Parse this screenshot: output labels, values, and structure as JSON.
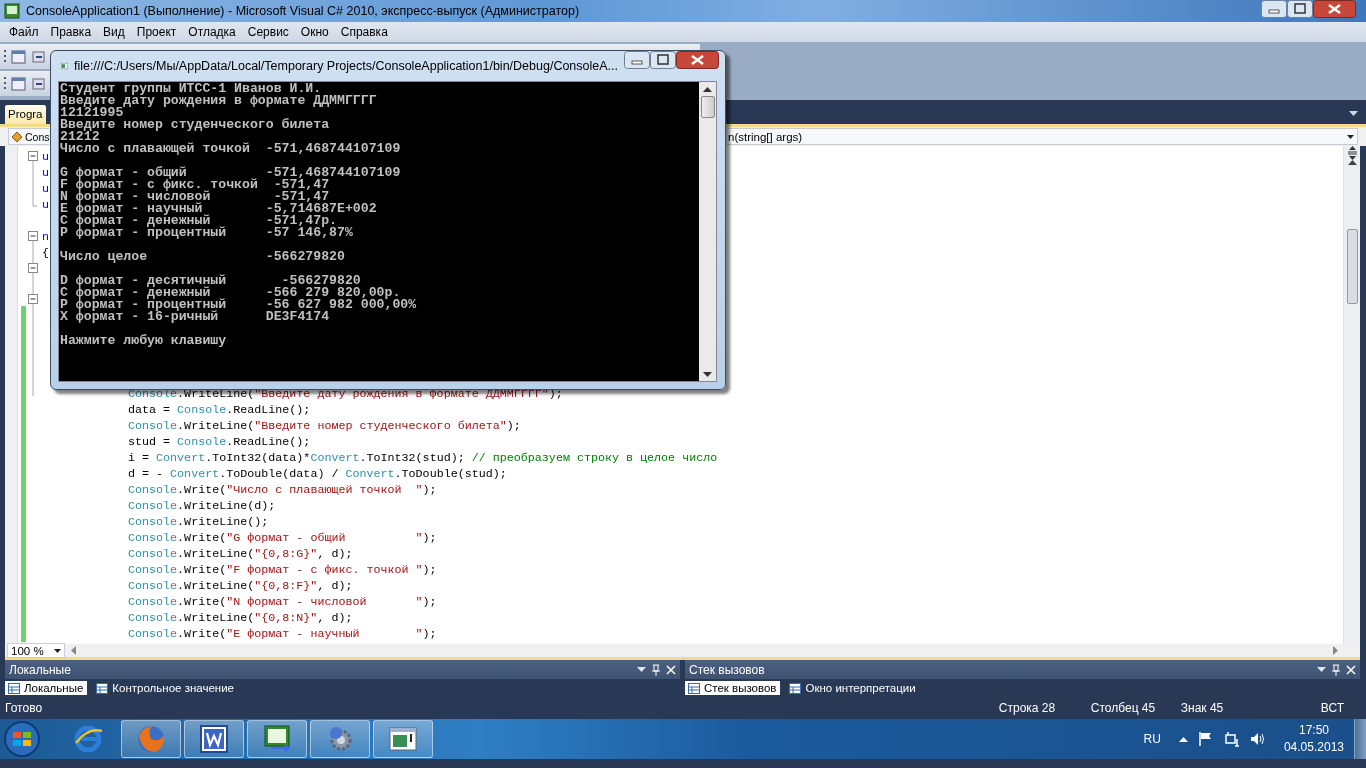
{
  "window": {
    "title": "ConsoleApplication1 (Выполнение) - Microsoft Visual C# 2010, экспресс-выпуск (Администратор)"
  },
  "menu": [
    "Файл",
    "Правка",
    "Вид",
    "Проект",
    "Отладка",
    "Сервис",
    "Окно",
    "Справка"
  ],
  "document_tabs": [
    {
      "label": "Progra",
      "selected": true
    }
  ],
  "navigation": {
    "type_combo": "Cons",
    "member_combo": "n(string[] args)"
  },
  "editor": {
    "fragments": [
      {
        "kind": "using",
        "text": "u"
      },
      {
        "kind": "using",
        "text": "u"
      },
      {
        "kind": "using",
        "text": "u"
      },
      {
        "kind": "using",
        "text": "u"
      },
      {
        "kind": "namespace",
        "text": "n"
      },
      {
        "kind": "brace",
        "text": "{"
      }
    ],
    "lines": [
      [
        {
          "kind": "type",
          "text": "Console"
        },
        {
          "kind": "plain",
          "text": ".WriteLine("
        },
        {
          "kind": "string",
          "text": "\"Введите дату рождения в формате ДДММГГГГ\""
        },
        {
          "kind": "plain",
          "text": ");"
        }
      ],
      [
        {
          "kind": "plain",
          "text": "data = "
        },
        {
          "kind": "type",
          "text": "Console"
        },
        {
          "kind": "plain",
          "text": ".ReadLine();"
        }
      ],
      [
        {
          "kind": "type",
          "text": "Console"
        },
        {
          "kind": "plain",
          "text": ".WriteLine("
        },
        {
          "kind": "string",
          "text": "\"Введите номер студенческого билета\""
        },
        {
          "kind": "plain",
          "text": ");"
        }
      ],
      [
        {
          "kind": "plain",
          "text": "stud = "
        },
        {
          "kind": "type",
          "text": "Console"
        },
        {
          "kind": "plain",
          "text": ".ReadLine();"
        }
      ],
      [
        {
          "kind": "plain",
          "text": "i = "
        },
        {
          "kind": "type",
          "text": "Convert"
        },
        {
          "kind": "plain",
          "text": ".ToInt32(data)*"
        },
        {
          "kind": "type",
          "text": "Convert"
        },
        {
          "kind": "plain",
          "text": ".ToInt32(stud); "
        },
        {
          "kind": "comment",
          "text": "// преобразуем строку в целое число"
        }
      ],
      [
        {
          "kind": "plain",
          "text": "d = - "
        },
        {
          "kind": "type",
          "text": "Convert"
        },
        {
          "kind": "plain",
          "text": ".ToDouble(data) / "
        },
        {
          "kind": "type",
          "text": "Convert"
        },
        {
          "kind": "plain",
          "text": ".ToDouble(stud);"
        }
      ],
      [
        {
          "kind": "type",
          "text": "Console"
        },
        {
          "kind": "plain",
          "text": ".Write("
        },
        {
          "kind": "string",
          "text": "\"Число с плавающей точкой  \""
        },
        {
          "kind": "plain",
          "text": ");"
        }
      ],
      [
        {
          "kind": "type",
          "text": "Console"
        },
        {
          "kind": "plain",
          "text": ".WriteLine(d);"
        }
      ],
      [
        {
          "kind": "type",
          "text": "Console"
        },
        {
          "kind": "plain",
          "text": ".WriteLine();"
        }
      ],
      [
        {
          "kind": "type",
          "text": "Console"
        },
        {
          "kind": "plain",
          "text": ".Write("
        },
        {
          "kind": "string",
          "text": "\"G формат - общий          \""
        },
        {
          "kind": "plain",
          "text": ");"
        }
      ],
      [
        {
          "kind": "type",
          "text": "Console"
        },
        {
          "kind": "plain",
          "text": ".WriteLine("
        },
        {
          "kind": "string",
          "text": "\"{0,8:G}\""
        },
        {
          "kind": "plain",
          "text": ", d);"
        }
      ],
      [
        {
          "kind": "type",
          "text": "Console"
        },
        {
          "kind": "plain",
          "text": ".Write("
        },
        {
          "kind": "string",
          "text": "\"F формат - с фикс. точкой \""
        },
        {
          "kind": "plain",
          "text": ");"
        }
      ],
      [
        {
          "kind": "type",
          "text": "Console"
        },
        {
          "kind": "plain",
          "text": ".WriteLine("
        },
        {
          "kind": "string",
          "text": "\"{0,8:F}\""
        },
        {
          "kind": "plain",
          "text": ", d);"
        }
      ],
      [
        {
          "kind": "type",
          "text": "Console"
        },
        {
          "kind": "plain",
          "text": ".Write("
        },
        {
          "kind": "string",
          "text": "\"N формат - числовой       \""
        },
        {
          "kind": "plain",
          "text": ");"
        }
      ],
      [
        {
          "kind": "type",
          "text": "Console"
        },
        {
          "kind": "plain",
          "text": ".WriteLine("
        },
        {
          "kind": "string",
          "text": "\"{0,8:N}\""
        },
        {
          "kind": "plain",
          "text": ", d);"
        }
      ],
      [
        {
          "kind": "type",
          "text": "Console"
        },
        {
          "kind": "plain",
          "text": ".Write("
        },
        {
          "kind": "string",
          "text": "\"E формат - научный        \""
        },
        {
          "kind": "plain",
          "text": ");"
        }
      ]
    ],
    "zoom": "100 %"
  },
  "panels": [
    {
      "title": "Локальные",
      "tabs": [
        {
          "label": "Локальные",
          "selected": true
        },
        {
          "label": "Контрольное значение",
          "selected": false
        }
      ]
    },
    {
      "title": "Стек вызовов",
      "tabs": [
        {
          "label": "Стек вызовов",
          "selected": true
        },
        {
          "label": "Окно интерпретации",
          "selected": false
        }
      ]
    }
  ],
  "status_bar": {
    "message": "Готово",
    "line": "Строка 28",
    "column": "Столбец 45",
    "char": "Знак 45",
    "mode": "ВСТ"
  },
  "console": {
    "title": "file:///C:/Users/Мы/AppData/Local/Temporary Projects/ConsoleApplication1/bin/Debug/ConsoleA...",
    "lines": [
      {
        "text": "Студент группы ИТСС-1 Иванов И.И.",
        "gap_before": false
      },
      {
        "text": "Введите дату рождения в формате ДДММГГГГ",
        "gap_before": false
      },
      {
        "text": "12121995",
        "gap_before": false
      },
      {
        "text": "Введите номер студенческого билета",
        "gap_before": false
      },
      {
        "text": "21212",
        "gap_before": false
      },
      {
        "text": "Число с плавающей точкой  -571,468744107109",
        "gap_before": false
      },
      {
        "text": "G формат - общий          -571,468744107109",
        "gap_before": true
      },
      {
        "text": "F формат - с фикс. точкой  -571,47",
        "gap_before": false
      },
      {
        "text": "N формат - числовой        -571,47",
        "gap_before": false
      },
      {
        "text": "E формат - научный        -5,714687E+002",
        "gap_before": false
      },
      {
        "text": "C формат - денежный       -571,47р.",
        "gap_before": false
      },
      {
        "text": "P формат - процентный     -57 146,87%",
        "gap_before": false
      },
      {
        "text": "Число целое               -566279820",
        "gap_before": true
      },
      {
        "text": "D формат - десятичный       -566279820",
        "gap_before": true
      },
      {
        "text": "C формат - денежный       -566 279 820,00р.",
        "gap_before": false
      },
      {
        "text": "P формат - процентный     -56 627 982 000,00%",
        "gap_before": false
      },
      {
        "text": "X формат - 16-ричный      DE3F4174",
        "gap_before": false
      },
      {
        "text": "Нажмите любую клавишу",
        "gap_before": true
      }
    ]
  },
  "taskbar": {
    "apps": [
      {
        "kind": "browser-e",
        "running": false
      },
      {
        "kind": "fox",
        "running": true
      },
      {
        "kind": "word",
        "running": true
      },
      {
        "kind": "csharp",
        "running": true
      },
      {
        "kind": "help",
        "running": true
      },
      {
        "kind": "console",
        "running": true
      }
    ],
    "language": "RU",
    "time": "17:50",
    "date": "04.05.2013"
  }
}
